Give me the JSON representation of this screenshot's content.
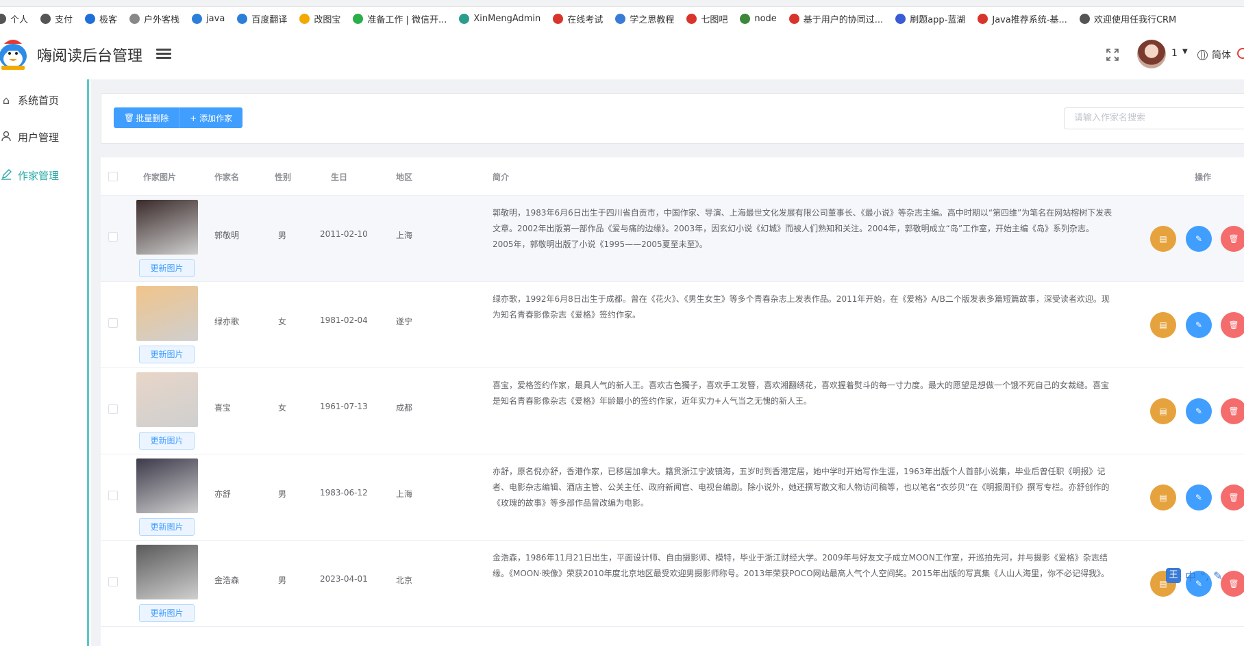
{
  "bookmarks": [
    {
      "label": "个人",
      "color": "#555555"
    },
    {
      "label": "支付",
      "color": "#555555"
    },
    {
      "label": "极客",
      "color": "#1e6fd9"
    },
    {
      "label": "户外客栈",
      "color": "#888888"
    },
    {
      "label": "java",
      "color": "#2b7fd9"
    },
    {
      "label": "百度翻译",
      "color": "#2b7fd9"
    },
    {
      "label": "改图宝",
      "color": "#f2a900"
    },
    {
      "label": "准备工作 | 微信开...",
      "color": "#2aae48"
    },
    {
      "label": "XinMengAdmin",
      "color": "#2a9d8f"
    },
    {
      "label": "在线考试",
      "color": "#d9342b"
    },
    {
      "label": "学之思教程",
      "color": "#3a7bd5"
    },
    {
      "label": "七图吧",
      "color": "#d9342b"
    },
    {
      "label": "node",
      "color": "#3c873a"
    },
    {
      "label": "基于用户的协同过...",
      "color": "#d9342b"
    },
    {
      "label": "刷题app-蓝湖",
      "color": "#3a5bd5"
    },
    {
      "label": "Java推荐系统-基...",
      "color": "#d9342b"
    },
    {
      "label": "欢迎使用任我行CRM",
      "color": "#555555"
    }
  ],
  "header": {
    "title": "嗨阅读后台管理",
    "user_num": "1",
    "lang": "简体"
  },
  "sidebar": {
    "items": [
      {
        "label": "系统首页",
        "icon": "home-icon"
      },
      {
        "label": "用户管理",
        "icon": "user-icon"
      },
      {
        "label": "作家管理",
        "icon": "edit-icon",
        "active": true
      }
    ]
  },
  "toolbar": {
    "delete_label": "批量删除",
    "add_label": "+ 添加作家",
    "search_placeholder": "请输入作家名搜索"
  },
  "table": {
    "headers": [
      "作家图片",
      "作家名",
      "性别",
      "生日",
      "地区",
      "简介",
      "操作"
    ],
    "update_label": "更新图片",
    "rows": [
      {
        "name": "郭敬明",
        "gender": "男",
        "birthday": "2011-02-10",
        "region": "上海",
        "intro": "郭敬明，1983年6月6日出生于四川省自贡市，中国作家、导演、上海最世文化发展有限公司董事长、《最小说》等杂志主编。高中时期以“第四维”为笔名在网站榕树下发表文章。2002年出版第一部作品《爱与痛的边缘》。2003年，因玄幻小说《幻城》而被人们熟知和关注。2004年，郭敬明成立“岛”工作室，开始主编《岛》系列杂志。2005年，郭敬明出版了小说《1995——2005夏至未至》。",
        "photo": "#3a2a2a"
      },
      {
        "name": "绿亦歌",
        "gender": "女",
        "birthday": "1981-02-04",
        "region": "遂宁",
        "intro": "绿亦歌，1992年6月8日出生于成都。曾在《花火》、《男生女生》等多个青春杂志上发表作品。2011年开始，在《爱格》A/B二个版发表多篇短篇故事，深受读者欢迎。现为知名青春影像杂志《爱格》签约作家。",
        "photo": "#f1c48a"
      },
      {
        "name": "喜宝",
        "gender": "女",
        "birthday": "1961-07-13",
        "region": "成都",
        "intro": "喜宝，爱格签约作家，最具人气的新人王。喜欢古色獨子，喜欢手工发簪，喜欢湘翻绣花，喜欢握着熨斗的每一寸力度。最大的愿望是想做一个饿不死自己的女裁缝。喜宝是知名青春影像杂志《爱格》年龄最小的签约作家，近年实力+人气当之无愧的新人王。",
        "photo": "#e8d6c8"
      },
      {
        "name": "亦舒",
        "gender": "男",
        "birthday": "1983-06-12",
        "region": "上海",
        "intro": "亦舒，原名倪亦舒，香港作家，已移居加拿大。籍贯浙江宁波镇海，五岁时到香港定居，她中学时开始写作生涯，1963年出版个人首部小说集，毕业后曾任职《明报》记者、电影杂志编辑、酒店主管、公关主任、政府新闻官、电视台编剧。除小说外，她还撰写散文和人物访问稿等，也以笔名“衣莎贝”在《明报周刊》撰写专栏。亦舒创作的《玫瑰的故事》等多部作品曾改编为电影。",
        "photo": "#3d3a4a"
      },
      {
        "name": "金浩森",
        "gender": "男",
        "birthday": "2023-04-01",
        "region": "北京",
        "intro": "金浩森，1986年11月21日出生，平面设计师、自由摄影师、模特，毕业于浙江财经大学。2009年与好友文子成立MOON工作室，开巡拍先河，并与摄影《爱格》杂志结缘。《MOON·映像》荣获2010年度北京地区最受欢迎男摄影师称号。2013年荣获POCO网站最高人气个人空间奖。2015年出版的写真集《人山人海里，你不必记得我》。",
        "photo": "#5a5a5a"
      }
    ]
  },
  "ime": {
    "badge": "王",
    "label": "中"
  }
}
